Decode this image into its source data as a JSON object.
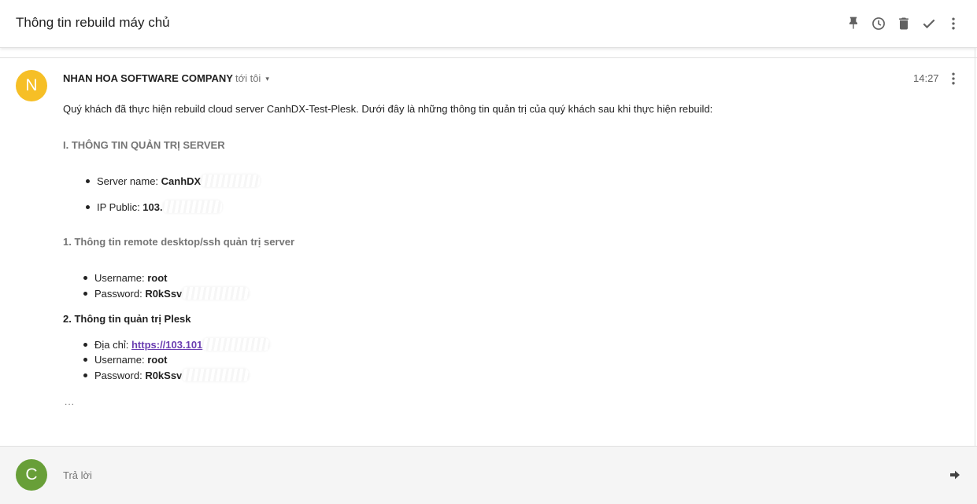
{
  "header": {
    "title": "Thông tin rebuild máy chủ",
    "icons": [
      "pin-icon",
      "snooze-clock-icon",
      "trash-icon",
      "check-done-icon",
      "more-vert-icon"
    ]
  },
  "message": {
    "avatar_letter": "N",
    "avatar_color": "#F6BF26",
    "sender": "NHAN HOA SOFTWARE COMPANY",
    "recipient": "tới tôi",
    "time": "14:27",
    "intro": "Quý khách đã thực hiện rebuild cloud server CanhDX-Test-Plesk. Dưới đây là những thông tin quản trị của quý khách sau khi thực hiện rebuild:",
    "section1": {
      "heading": "I. THÔNG TIN QUẢN TRỊ SERVER",
      "items": [
        {
          "label": "Server name: ",
          "value": "CanhDX"
        },
        {
          "label": "IP Public: ",
          "value": "103."
        }
      ]
    },
    "section2": {
      "heading": "1. Thông tin remote desktop/ssh quản trị server",
      "items": [
        {
          "label": "Username: ",
          "value": "root"
        },
        {
          "label": "Password: ",
          "value": "R0kSsv"
        }
      ]
    },
    "section3": {
      "heading": "2. Thông tin quản trị Plesk",
      "items": [
        {
          "label": "Địa chỉ: ",
          "value": "https://103.101"
        },
        {
          "label": "Username: ",
          "value": "root"
        },
        {
          "label": "Password: ",
          "value": "R0kSsv"
        }
      ]
    },
    "trimmed_indicator": "..."
  },
  "reply": {
    "avatar_letter": "C",
    "avatar_color": "#689F38",
    "placeholder": "Trả lời"
  },
  "colors": {
    "link": "#6A3DB1",
    "heading_grey": "#757575"
  }
}
